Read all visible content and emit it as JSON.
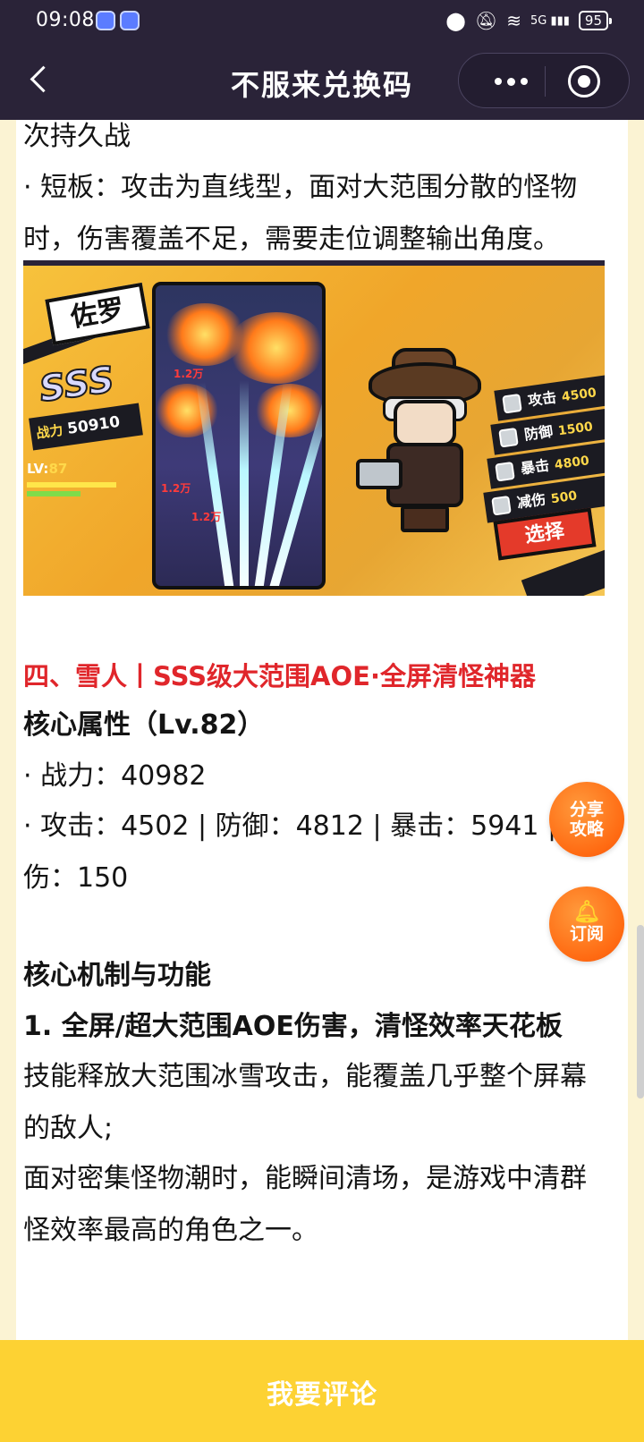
{
  "status_bar": {
    "time": "09:08",
    "battery": "95",
    "signal_label": "5G"
  },
  "nav": {
    "title": "不服来兑换码"
  },
  "article": {
    "para_top": "次持久战",
    "shortcoming": "· 短板：攻击为直线型，面对大范围分散的怪物时，伤害覆盖不足，需要走位调整输出角度。",
    "game_image": {
      "hero_name": "佐罗",
      "rank": "SSS",
      "power_label": "战力",
      "power_value": "50910",
      "level_label": "LV:",
      "level_value": "87",
      "damage_numbers": [
        "1.2万",
        "1.2万",
        "1.2万"
      ],
      "stats": [
        {
          "label": "攻击",
          "value": "4500"
        },
        {
          "label": "防御",
          "value": "1500"
        },
        {
          "label": "暴击",
          "value": "4800"
        },
        {
          "label": "减伤",
          "value": "500"
        }
      ],
      "select_label": "选择"
    },
    "section_heading": "四、雪人丨SSS级大范围AOE·全屏清怪神器",
    "core_attr_title": "核心属性（Lv.82）",
    "power_line": "· 战力：40982",
    "stats_line": "· 攻击：4502 | 防御：4812 | 暴击：5941 | 减伤：150",
    "mechanism_title": "核心机制与功能",
    "point1_title": "1. 全屏/超大范围AOE伤害，清怪效率天花板",
    "point1_line1": "技能释放大范围冰雪攻击，能覆盖几乎整个屏幕的敌人;",
    "point1_line2": "面对密集怪物潮时，能瞬间清场，是游戏中清群怪效率最高的角色之一。"
  },
  "floating": {
    "share_line1": "分享",
    "share_line2": "攻略",
    "subscribe": "订阅"
  },
  "bottom": {
    "comment_label": "我要评论"
  },
  "colors": {
    "header_bg": "#2a2338",
    "page_bg": "#fbf3d3",
    "heading_red": "#e0262b",
    "fab_orange": "#ff6a12",
    "bottom_bar": "#fdd233"
  }
}
